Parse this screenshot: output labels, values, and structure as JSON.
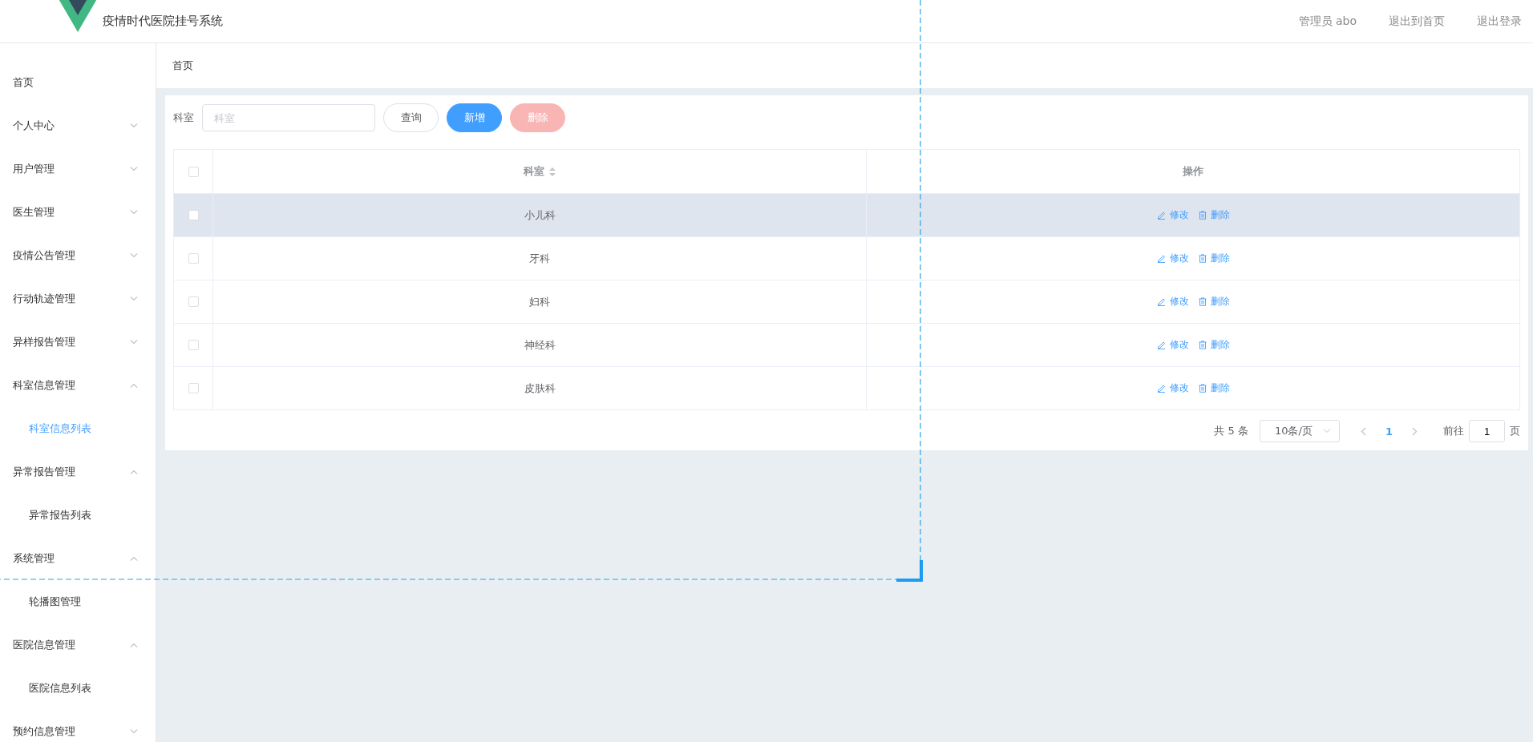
{
  "header": {
    "title": "疫情时代医院挂号系统",
    "user": "管理员 abo",
    "links": [
      "退出到首页",
      "退出登录"
    ]
  },
  "sidebar": {
    "items": [
      {
        "label": "首页",
        "kind": "link"
      },
      {
        "label": "个人中心",
        "kind": "group",
        "expanded": false
      },
      {
        "label": "用户管理",
        "kind": "group",
        "expanded": false
      },
      {
        "label": "医生管理",
        "kind": "group",
        "expanded": false
      },
      {
        "label": "疫情公告管理",
        "kind": "group",
        "expanded": false
      },
      {
        "label": "行动轨迹管理",
        "kind": "group",
        "expanded": false
      },
      {
        "label": "异样报告管理",
        "kind": "group",
        "expanded": false
      },
      {
        "label": "科室信息管理",
        "kind": "group",
        "expanded": true,
        "children": [
          {
            "label": "科室信息列表",
            "selected": true
          }
        ]
      },
      {
        "label": "异常报告管理",
        "kind": "group",
        "expanded": true,
        "children": [
          {
            "label": "异常报告列表",
            "selected": false
          }
        ]
      },
      {
        "label": "系统管理",
        "kind": "group",
        "expanded": true,
        "children": [
          {
            "label": "轮播图管理",
            "selected": false
          }
        ]
      },
      {
        "label": "医院信息管理",
        "kind": "group",
        "expanded": true,
        "children": [
          {
            "label": "医院信息列表",
            "selected": false
          }
        ]
      },
      {
        "label": "预约信息管理",
        "kind": "group",
        "expanded": false
      }
    ]
  },
  "breadcrumb": "首页",
  "search": {
    "label": "科室",
    "placeholder": "科室",
    "buttons": [
      {
        "label": "查询",
        "kind": "plain",
        "disabled": false
      },
      {
        "label": "新增",
        "kind": "primary",
        "disabled": false
      },
      {
        "label": "删除",
        "kind": "danger",
        "disabled": true
      }
    ]
  },
  "table": {
    "columns": [
      "科室",
      "操作"
    ],
    "rows": [
      {
        "department": "小儿科",
        "checked": false,
        "hovered": true,
        "actions": [
          "修改",
          "删除"
        ]
      },
      {
        "department": "牙科",
        "checked": false,
        "hovered": false,
        "actions": [
          "修改",
          "删除"
        ]
      },
      {
        "department": "妇科",
        "checked": false,
        "hovered": false,
        "actions": [
          "修改",
          "删除"
        ]
      },
      {
        "department": "神经科",
        "checked": false,
        "hovered": false,
        "actions": [
          "修改",
          "删除"
        ]
      },
      {
        "department": "皮肤科",
        "checked": false,
        "hovered": false,
        "actions": [
          "修改",
          "删除"
        ]
      }
    ],
    "all_checked": false
  },
  "pagination": {
    "total": "共 5 条",
    "page_size": "10条/页",
    "pages": [
      {
        "label": "1",
        "selected": true
      }
    ],
    "goto_label": "前往",
    "goto_value": "1",
    "goto_suffix": "页"
  }
}
